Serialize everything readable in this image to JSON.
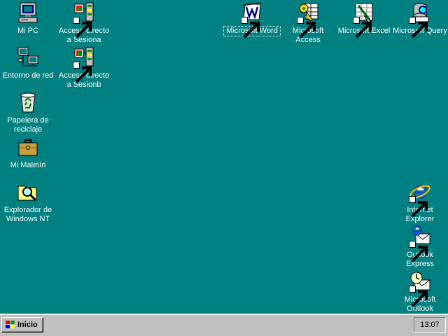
{
  "desktop": {
    "icons": [
      {
        "label": "Mi PC",
        "icon": "computer-icon"
      },
      {
        "label": "Acceso directo a Sesiona",
        "icon": "session-shortcut-icon"
      },
      {
        "label": "Microsoft Word",
        "icon": "word-icon"
      },
      {
        "label": "Microsoft Access",
        "icon": "access-icon"
      },
      {
        "label": "Microsoft Excel",
        "icon": "excel-icon"
      },
      {
        "label": "Microsoft Query",
        "icon": "query-icon"
      },
      {
        "label": "Entorno de red",
        "icon": "network-icon"
      },
      {
        "label": "Acceso directo a Sesionb",
        "icon": "session-shortcut-icon"
      },
      {
        "label": "Papelera de reciclaje",
        "icon": "recycle-bin-icon"
      },
      {
        "label": "Mi Maletín",
        "icon": "briefcase-icon"
      },
      {
        "label": "Explorador de Windows NT",
        "icon": "explorer-icon"
      },
      {
        "label": "Internet Explorer",
        "icon": "ie-icon"
      },
      {
        "label": "Outlook Express",
        "icon": "outlook-express-icon"
      },
      {
        "label": "Microsoft Outlook",
        "icon": "outlook-icon"
      }
    ]
  },
  "taskbar": {
    "start_label": "Inicio",
    "clock": "13:07"
  },
  "colors": {
    "desktop_bg": "#008080",
    "taskbar_bg": "#c0c0c0"
  }
}
